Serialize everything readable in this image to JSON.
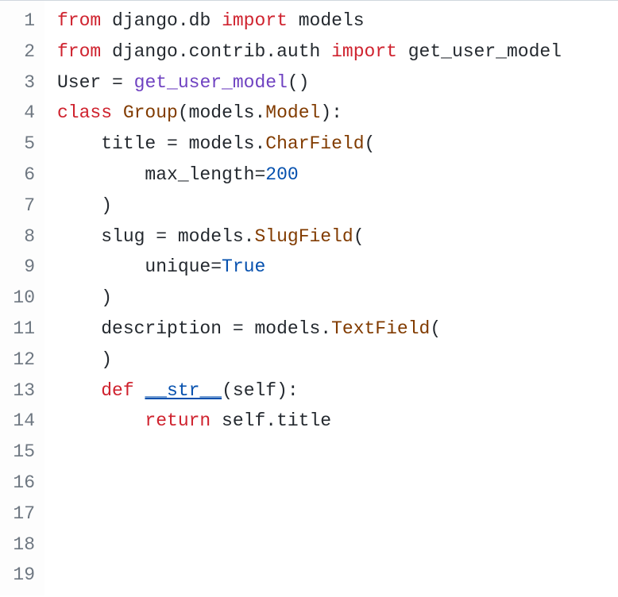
{
  "lines": [
    {
      "n": 1,
      "tokens": [
        [
          "kw",
          "from"
        ],
        [
          "ident",
          " django"
        ],
        [
          "op",
          "."
        ],
        [
          "ident",
          "db "
        ],
        [
          "kw",
          "import"
        ],
        [
          "ident",
          " models"
        ]
      ]
    },
    {
      "n": 2,
      "tokens": [
        [
          "kw",
          "from"
        ],
        [
          "ident",
          " django"
        ],
        [
          "op",
          "."
        ],
        [
          "ident",
          "contrib"
        ],
        [
          "op",
          "."
        ],
        [
          "ident",
          "auth "
        ],
        [
          "kw",
          "import"
        ],
        [
          "ident",
          " get_user_model"
        ]
      ]
    },
    {
      "n": 3,
      "tokens": [
        [
          "ident",
          ""
        ]
      ]
    },
    {
      "n": 4,
      "tokens": [
        [
          "ident",
          "User "
        ],
        [
          "op",
          "="
        ],
        [
          "ident",
          " "
        ],
        [
          "fn",
          "get_user_model"
        ],
        [
          "op",
          "()"
        ]
      ]
    },
    {
      "n": 5,
      "tokens": [
        [
          "ident",
          ""
        ]
      ]
    },
    {
      "n": 6,
      "tokens": [
        [
          "ident",
          ""
        ]
      ]
    },
    {
      "n": 7,
      "tokens": [
        [
          "kw",
          "class"
        ],
        [
          "ident",
          " "
        ],
        [
          "cls",
          "Group"
        ],
        [
          "op",
          "("
        ],
        [
          "ident",
          "models"
        ],
        [
          "op",
          "."
        ],
        [
          "cls",
          "Model"
        ],
        [
          "op",
          ")"
        ],
        [
          "op",
          ":"
        ]
      ]
    },
    {
      "n": 8,
      "tokens": [
        [
          "ident",
          "    title "
        ],
        [
          "op",
          "="
        ],
        [
          "ident",
          " models"
        ],
        [
          "op",
          "."
        ],
        [
          "cls",
          "CharField"
        ],
        [
          "op",
          "("
        ]
      ]
    },
    {
      "n": 9,
      "tokens": [
        [
          "ident",
          "        max_length"
        ],
        [
          "op",
          "="
        ],
        [
          "num",
          "200"
        ]
      ]
    },
    {
      "n": 10,
      "tokens": [
        [
          "ident",
          "    "
        ],
        [
          "op",
          ")"
        ]
      ]
    },
    {
      "n": 11,
      "tokens": [
        [
          "ident",
          "    slug "
        ],
        [
          "op",
          "="
        ],
        [
          "ident",
          " models"
        ],
        [
          "op",
          "."
        ],
        [
          "cls",
          "SlugField"
        ],
        [
          "op",
          "("
        ]
      ]
    },
    {
      "n": 12,
      "tokens": [
        [
          "ident",
          "        unique"
        ],
        [
          "op",
          "="
        ],
        [
          "bool",
          "True"
        ]
      ]
    },
    {
      "n": 13,
      "tokens": [
        [
          "ident",
          "    "
        ],
        [
          "op",
          ")"
        ]
      ]
    },
    {
      "n": 14,
      "tokens": [
        [
          "ident",
          "    description "
        ],
        [
          "op",
          "="
        ],
        [
          "ident",
          " models"
        ],
        [
          "op",
          "."
        ],
        [
          "cls",
          "TextField"
        ],
        [
          "op",
          "("
        ]
      ]
    },
    {
      "n": 15,
      "tokens": [
        [
          "ident",
          "    "
        ],
        [
          "op",
          ")"
        ]
      ]
    },
    {
      "n": 16,
      "tokens": [
        [
          "ident",
          ""
        ]
      ]
    },
    {
      "n": 17,
      "tokens": [
        [
          "ident",
          "    "
        ],
        [
          "kw",
          "def"
        ],
        [
          "ident",
          " "
        ],
        [
          "dundr",
          "__str__"
        ],
        [
          "op",
          "("
        ],
        [
          "ident",
          "self"
        ],
        [
          "op",
          ")"
        ],
        [
          "op",
          ":"
        ]
      ]
    },
    {
      "n": 18,
      "tokens": [
        [
          "ident",
          "        "
        ],
        [
          "kw",
          "return"
        ],
        [
          "ident",
          " self"
        ],
        [
          "op",
          "."
        ],
        [
          "ident",
          "title"
        ]
      ]
    },
    {
      "n": 19,
      "tokens": [
        [
          "ident",
          ""
        ]
      ]
    }
  ]
}
